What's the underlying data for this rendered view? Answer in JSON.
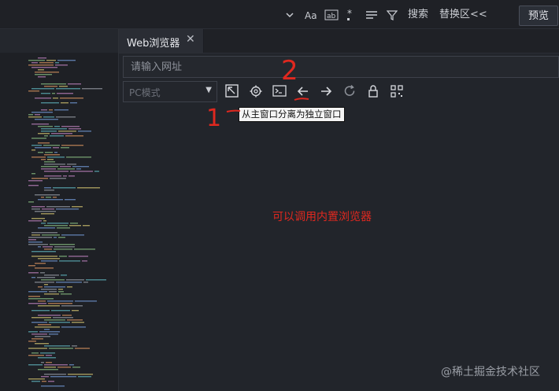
{
  "toolbar": {
    "search_label": "搜索",
    "replace_label": "替换区<<",
    "preview_label": "预览"
  },
  "browser": {
    "tab_title": "Web浏览器",
    "url_placeholder": "请输入网址",
    "mode_selected": "PC模式",
    "tooltip": "从主窗口分离为独立窗口"
  },
  "annotations": {
    "note": "可以调用内置浏览器",
    "marker_1": "1",
    "marker_2": "2"
  },
  "watermark": "@稀土掘金技术社区",
  "colors": {
    "background": "#22252b",
    "annotation": "#e0281f"
  }
}
